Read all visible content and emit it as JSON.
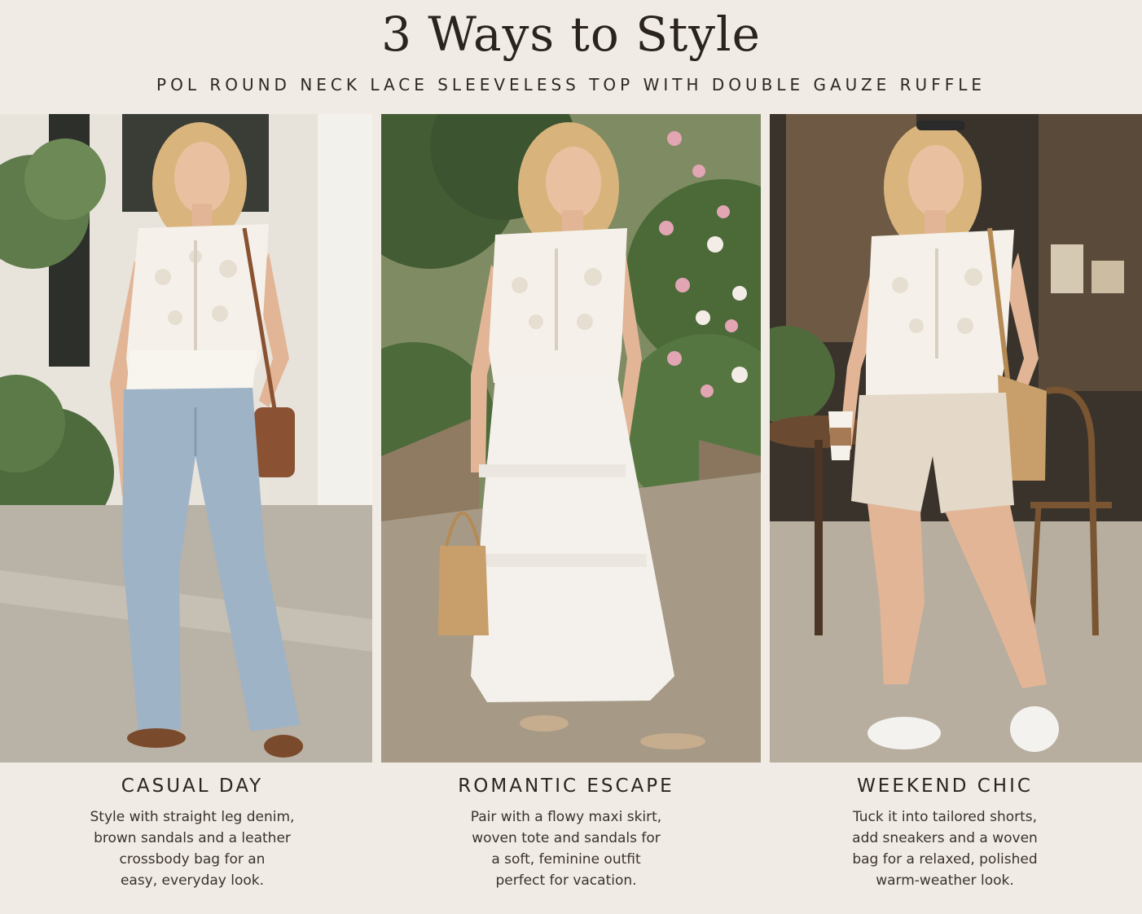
{
  "header": {
    "title": "3 Ways to Style",
    "subtitle": "POL ROUND NECK LACE SLEEVELESS TOP WITH DOUBLE GAUZE RUFFLE"
  },
  "looks": [
    {
      "title": "CASUAL DAY",
      "text": "Style with straight leg denim,\nbrown sandals and a leather\ncrossbody bag for an\neasy, everyday look."
    },
    {
      "title": "ROMANTIC ESCAPE",
      "text": "Pair with a flowy maxi skirt,\nwoven tote and sandals for\na soft, feminine outfit\nperfect for vacation."
    },
    {
      "title": "WEEKEND CHIC",
      "text": "Tuck it into tailored shorts,\nadd sneakers and a woven\nbag for a relaxed, polished\nwarm-weather look."
    }
  ],
  "colors": {
    "background": "#f1ebe5",
    "text": "#2c2520",
    "top": "#f5f1ea",
    "denim": "#9fb3c6",
    "skirt": "#f4f1ed",
    "shorts": "#e4d9c8",
    "leather": "#8a5232",
    "straw": "#c89f6a"
  }
}
